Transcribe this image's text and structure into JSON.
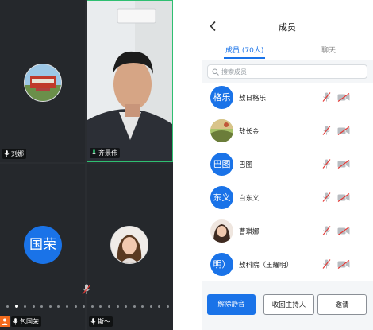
{
  "video_grid": {
    "tiles": [
      {
        "name": "刘娜",
        "mic": "on"
      },
      {
        "name": "齐景伟",
        "mic": "on"
      },
      {
        "name": "包国荣",
        "avatar_text": "国荣",
        "mic": "on"
      },
      {
        "name": "斯～",
        "mic": "on"
      }
    ],
    "page_count": 20,
    "active_page": 1
  },
  "panel": {
    "title": "成员",
    "tabs": [
      {
        "label": "成员 (70人)",
        "active": true
      },
      {
        "label": "聊天",
        "active": false
      }
    ],
    "search": {
      "placeholder": "搜索成员"
    },
    "members": [
      {
        "avatar_text": "格乐",
        "name": "敖日格乐",
        "avatar": "text"
      },
      {
        "avatar_text": "",
        "name": "敖长金",
        "avatar": "photo-landscape"
      },
      {
        "avatar_text": "巴图",
        "name": "巴图",
        "avatar": "text"
      },
      {
        "avatar_text": "东义",
        "name": "白东义",
        "avatar": "text"
      },
      {
        "avatar_text": "",
        "name": "曹琪娜",
        "avatar": "photo-portrait"
      },
      {
        "avatar_text": "明）",
        "name": "敖科院（王耀明）",
        "avatar": "text"
      }
    ],
    "buttons": {
      "unmute_all": "解除静音",
      "reclaim_host": "收回主持人",
      "invite": "邀请"
    }
  },
  "colors": {
    "accent": "#1a73e8",
    "active_speaker_border": "#2fbf71",
    "muted_red": "#e53935",
    "host_badge": "#f26b1d"
  }
}
